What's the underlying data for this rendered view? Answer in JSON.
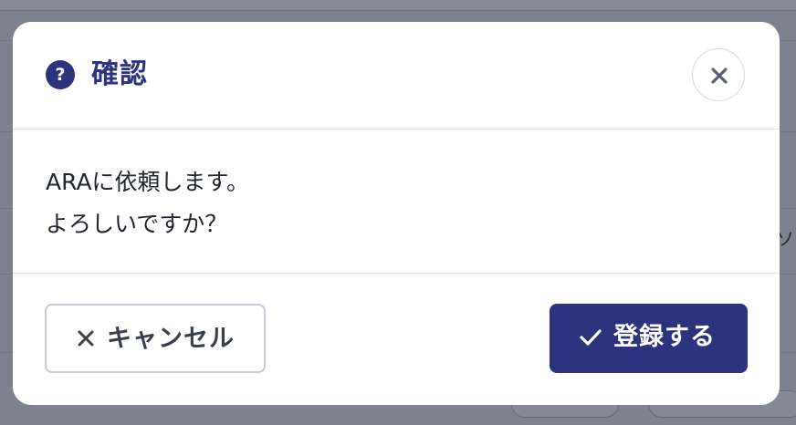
{
  "background": {
    "snippet_text": "ソー"
  },
  "dialog": {
    "icon": "question-circle-icon",
    "title": "確認",
    "close_icon": "close-icon",
    "message_lines": [
      "ARAに依頼します。",
      "よろしいですか？"
    ],
    "cancel_button": {
      "icon": "close-icon",
      "label": "キャンセル"
    },
    "submit_button": {
      "icon": "check-icon",
      "label": "登録する"
    }
  },
  "colors": {
    "primary": "#2d337d",
    "overlay": "#7e828f",
    "text": "#20242e",
    "border": "#c6ccd7"
  }
}
